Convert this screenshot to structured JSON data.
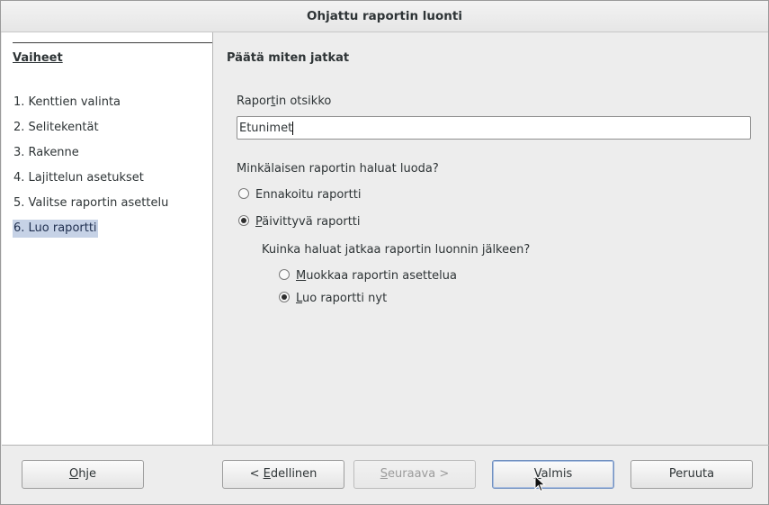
{
  "window": {
    "title": "Ohjattu raportin luonti"
  },
  "sidebar": {
    "title": "Vaiheet",
    "steps": [
      {
        "label": "1. Kenttien valinta"
      },
      {
        "label": "2. Selitekentät"
      },
      {
        "label": "3. Rakenne"
      },
      {
        "label": "4. Lajittelun asetukset"
      },
      {
        "label": "5. Valitse raportin asettelu"
      },
      {
        "label": "6. Luo raportti"
      }
    ],
    "active_step": "6. Luo raportti"
  },
  "main": {
    "heading": "Päätä miten jatkat",
    "title_label_pre": "Rapor",
    "title_label_mnemonic": "t",
    "title_label_post": "in otsikko",
    "title_value": "Etunimet",
    "report_type_question": "Minkälaisen raportin haluat luoda?",
    "report_types": {
      "static": {
        "label": "Ennakoitu raportti",
        "selected": false
      },
      "dynamic": {
        "label_mnemonic": "P",
        "label_rest": "äivittyvä raportti",
        "selected": true
      }
    },
    "after_question": "Kuinka haluat jatkaa raportin luonnin jälkeen?",
    "after_options": {
      "modify": {
        "label_mnemonic": "M",
        "label_rest": "uokkaa raportin asettelua",
        "selected": false
      },
      "create": {
        "label_mnemonic": "L",
        "label_rest": "uo raportti nyt",
        "selected": true
      }
    }
  },
  "buttons": {
    "help": {
      "mnemonic": "O",
      "rest": "hje"
    },
    "back": {
      "pre": "< ",
      "mnemonic": "E",
      "rest": "dellinen"
    },
    "next": {
      "mnemonic": "S",
      "rest": "euraava >",
      "enabled": false
    },
    "finish": {
      "mnemonic": "V",
      "rest": "almis"
    },
    "cancel": {
      "label": "Peruuta"
    }
  }
}
